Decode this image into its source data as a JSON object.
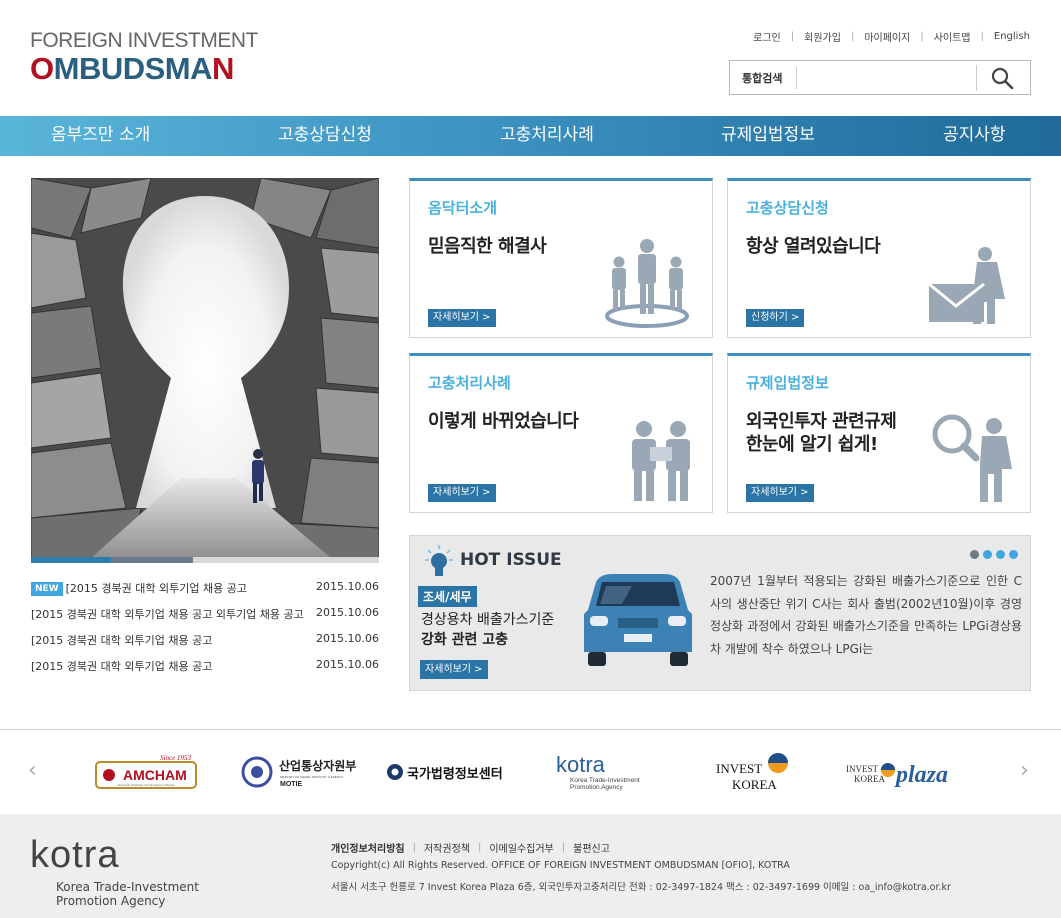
{
  "logo": {
    "line1": "FOREIGN INVESTMENT",
    "line2_o": "O",
    "line2_rest": "MBUDSMA",
    "line2_n": "N"
  },
  "util": [
    "로그인",
    "회원가입",
    "마이페이지",
    "사이트맵",
    "English"
  ],
  "search": {
    "label": "통합검색",
    "value": ""
  },
  "nav": [
    "옴부즈만 소개",
    "고충상담신청",
    "고충처리사례",
    "규제입법정보",
    "공지사항"
  ],
  "news": [
    {
      "badge": "NEW",
      "title": "[2015 경북권 대학 외투기업 채용 공고",
      "date": "2015.10.06"
    },
    {
      "badge": "",
      "title": "[2015 경북권 대학 외투기업 채용 공고 외투기업 채용 공고",
      "date": "2015.10.06"
    },
    {
      "badge": "",
      "title": "[2015 경북권 대학 외투기업 채용 공고",
      "date": "2015.10.06"
    },
    {
      "badge": "",
      "title": "[2015 경북권 대학 외투기업 채용 공고",
      "date": "2015.10.06"
    }
  ],
  "cards": [
    {
      "category": "옴닥터소개",
      "headline": "믿음직한 해결사",
      "headline2": "",
      "button": "자세히보기 >"
    },
    {
      "category": "고충상담신청",
      "headline": "항상 열려있습니다",
      "headline2": "",
      "button": "신청하기 >"
    },
    {
      "category": "고충처리사례",
      "headline": "이렇게 바뀌었습니다",
      "headline2": "",
      "button": "자세히보기 >"
    },
    {
      "category": "규제입법정보",
      "headline": "외국인투자 관련규제",
      "headline2": "한눈에 알기 쉽게!",
      "button": "자세히보기 >"
    }
  ],
  "hot_issue": {
    "title": "HOT ISSUE",
    "category": "조세/세무",
    "headline1": "경상용차 배출가스기준",
    "headline2": "강화 관련 고충",
    "button": "자세히보기 >",
    "body": "2007년 1월부터 적용되는 강화된 배출가스기준으로 인한 C사의 생산중단 위기 C사는 회사 출범(2002년10월)이후 경영정상화 과정에서 강화된 배출가스기준을 만족하는 LPGi경상용차 개발에 착수 하였으나 LPGi는"
  },
  "partners": {
    "amcham": {
      "since": "Since 1953",
      "name": "AMCHAM",
      "sub": "American Chamber of Commerce in Korea"
    },
    "motie": {
      "name": "산업통상자원부",
      "sub": "MINISTRY OF TRADE, INDUSTRY & ENERGY",
      "abbr": "MOTIE"
    },
    "law": {
      "name": "국가법령정보센터"
    },
    "kotra": {
      "name": "kotra",
      "sub1": "Korea Trade-Investment",
      "sub2": "Promotion Agency"
    },
    "invest_korea": {
      "line1": "INVEST",
      "line2": "KOREA"
    },
    "plaza": {
      "small1": "INVEST",
      "small2": "KOREA",
      "name": "plaza"
    }
  },
  "footer": {
    "logo": "kotra",
    "logo_sub1": "Korea Trade-Investment",
    "logo_sub2": "Promotion Agency",
    "links": [
      "개인정보처리방침",
      "저작권정책",
      "이메일수집거부",
      "불편신고"
    ],
    "copyright": "Copyright(c) All Rights Reserved. OFFICE OF FOREIGN INVESTMENT OMBUDSMAN [OFIO], KOTRA",
    "address": "서울시 서초구 헌릉로 7 Invest Korea Plaza 6층, 외국인투자고충처리단 전화 : 02-3497-1824 팩스 : 02-3497-1699 이메일 : oa_info@kotra.or.kr"
  },
  "colors": {
    "accent": "#3a8fbe",
    "brand_red": "#b01020",
    "badge_blue": "#3ea7e0",
    "button_blue": "#2b74a6"
  }
}
